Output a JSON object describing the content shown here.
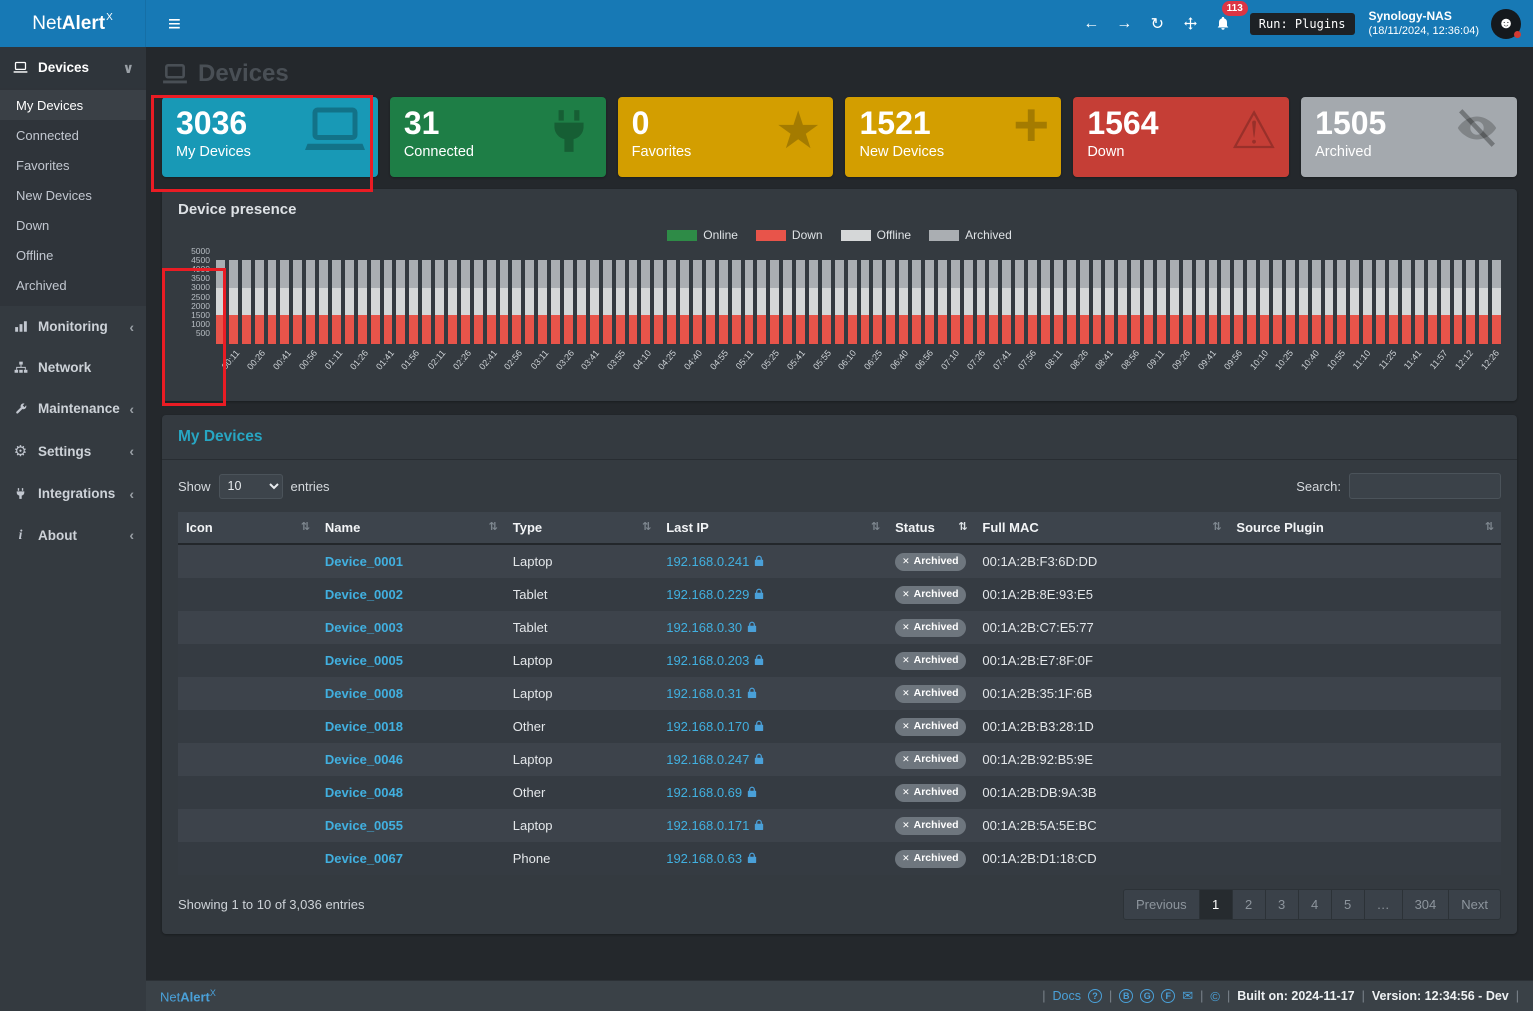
{
  "colors": {
    "topbar": "#1779b5",
    "sidebar": "#343a40",
    "content_bg": "#24282c",
    "panel_bg": "#343a40",
    "link_accent": "#41b0e0",
    "panel_title_cyan": "#27a6c3",
    "annotation_red": "#ea1c24",
    "status_badge_bg": "#6e767e",
    "notification_badge": "#dc3545"
  },
  "topbar": {
    "logo_net": "Net",
    "logo_alert": "Alert",
    "logo_x": "X",
    "notification_count": "113",
    "tooltip": "Run: Plugins",
    "host": "Synology-NAS",
    "timestamp": "(18/11/2024, 12:36:04)"
  },
  "sidebar": {
    "sections": [
      {
        "label": "Devices",
        "icon": "laptop-icon",
        "chevron": "down",
        "active": true
      },
      {
        "label": "Monitoring",
        "icon": "chart-icon",
        "chevron": "left"
      },
      {
        "label": "Network",
        "icon": "network-icon",
        "chevron": "none"
      },
      {
        "label": "Maintenance",
        "icon": "wrench-icon",
        "chevron": "left"
      },
      {
        "label": "Settings",
        "icon": "gear-icon",
        "chevron": "left"
      },
      {
        "label": "Integrations",
        "icon": "plug-icon",
        "chevron": "left"
      },
      {
        "label": "About",
        "icon": "info-icon",
        "chevron": "left"
      }
    ],
    "devices_children": [
      "My Devices",
      "Connected",
      "Favorites",
      "New Devices",
      "Down",
      "Offline",
      "Archived"
    ],
    "active_child": "My Devices"
  },
  "page": {
    "title": "Devices"
  },
  "stat_cards": [
    {
      "value": "3036",
      "label": "My Devices",
      "color": "#1899b6",
      "icon": "laptop-icon",
      "annotated": true
    },
    {
      "value": "31",
      "label": "Connected",
      "color": "#1e7e46",
      "icon": "plug-icon"
    },
    {
      "value": "0",
      "label": "Favorites",
      "color": "#d39e00",
      "icon": "star-icon"
    },
    {
      "value": "1521",
      "label": "New Devices",
      "color": "#d39e00",
      "icon": "plus-icon"
    },
    {
      "value": "1564",
      "label": "Down",
      "color": "#c53e36",
      "icon": "warning-icon"
    },
    {
      "value": "1505",
      "label": "Archived",
      "color": "#a4a9ae",
      "icon": "eye-slash-icon"
    }
  ],
  "presence": {
    "title": "Device presence",
    "chart_data": {
      "type": "bar",
      "stacked": true,
      "legend_position": "top",
      "bars_per_tick": 2,
      "ylim": [
        0,
        5000
      ],
      "yticks": [
        500,
        1000,
        1500,
        2000,
        2500,
        3000,
        3500,
        4000,
        4500,
        5000
      ],
      "x": [
        "00:11",
        "00:26",
        "00:41",
        "00:56",
        "01:11",
        "01:26",
        "01:41",
        "01:56",
        "02:11",
        "02:26",
        "02:41",
        "02:56",
        "03:11",
        "03:26",
        "03:41",
        "03:55",
        "04:10",
        "04:25",
        "04:40",
        "04:55",
        "05:11",
        "05:25",
        "05:41",
        "05:55",
        "06:10",
        "06:25",
        "06:40",
        "06:56",
        "07:10",
        "07:26",
        "07:41",
        "07:56",
        "08:11",
        "08:26",
        "08:41",
        "08:56",
        "09:11",
        "09:26",
        "09:41",
        "09:56",
        "10:10",
        "10:25",
        "10:40",
        "10:55",
        "11:10",
        "11:25",
        "11:41",
        "11:57",
        "12:12",
        "12:26"
      ],
      "series": [
        {
          "name": "Online",
          "color": "#2e8b47",
          "values": [
            0,
            0,
            0,
            0,
            0,
            0,
            0,
            0,
            0,
            0,
            0,
            0,
            0,
            0,
            0,
            0,
            0,
            0,
            0,
            0,
            0,
            0,
            0,
            0,
            0,
            0,
            0,
            0,
            0,
            0,
            0,
            0,
            0,
            0,
            0,
            0,
            0,
            0,
            0,
            0,
            0,
            0,
            0,
            0,
            0,
            0,
            0,
            0,
            0,
            0
          ]
        },
        {
          "name": "Down",
          "color": "#e8544a",
          "values": [
            1564,
            1564,
            1564,
            1564,
            1564,
            1564,
            1564,
            1564,
            1564,
            1564,
            1564,
            1564,
            1564,
            1564,
            1564,
            1564,
            1564,
            1564,
            1564,
            1564,
            1564,
            1564,
            1564,
            1564,
            1564,
            1564,
            1564,
            1564,
            1564,
            1564,
            1564,
            1564,
            1564,
            1564,
            1564,
            1564,
            1564,
            1564,
            1564,
            1564,
            1564,
            1564,
            1564,
            1564,
            1564,
            1564,
            1564,
            1564,
            1564,
            1564
          ]
        },
        {
          "name": "Offline",
          "color": "#d5d7d8",
          "values": [
            1490,
            1490,
            1490,
            1490,
            1490,
            1490,
            1490,
            1490,
            1490,
            1490,
            1490,
            1490,
            1490,
            1490,
            1490,
            1490,
            1490,
            1490,
            1490,
            1490,
            1490,
            1490,
            1490,
            1490,
            1490,
            1490,
            1490,
            1490,
            1490,
            1490,
            1490,
            1490,
            1490,
            1490,
            1490,
            1490,
            1490,
            1490,
            1490,
            1490,
            1490,
            1490,
            1490,
            1490,
            1490,
            1490,
            1490,
            1490,
            1490,
            1490
          ]
        },
        {
          "name": "Archived",
          "color": "#aaaeb2",
          "values": [
            1505,
            1505,
            1505,
            1505,
            1505,
            1505,
            1505,
            1505,
            1505,
            1505,
            1505,
            1505,
            1505,
            1505,
            1505,
            1505,
            1505,
            1505,
            1505,
            1505,
            1505,
            1505,
            1505,
            1505,
            1505,
            1505,
            1505,
            1505,
            1505,
            1505,
            1505,
            1505,
            1505,
            1505,
            1505,
            1505,
            1505,
            1505,
            1505,
            1505,
            1505,
            1505,
            1505,
            1505,
            1505,
            1505,
            1505,
            1505,
            1505,
            1505
          ]
        }
      ]
    }
  },
  "table": {
    "title": "My Devices",
    "controls": {
      "show_label": "Show",
      "page_length": "10",
      "entries_label": "entries",
      "search_label": "Search:",
      "search_value": ""
    },
    "columns": [
      {
        "label": "Icon"
      },
      {
        "label": "Name"
      },
      {
        "label": "Type"
      },
      {
        "label": "Last IP"
      },
      {
        "label": "Status",
        "sorted": true
      },
      {
        "label": "Full MAC"
      },
      {
        "label": "Source Plugin"
      }
    ],
    "rows": [
      {
        "name": "Device_0001",
        "type": "Laptop",
        "ip": "192.168.0.241",
        "status": "Archived",
        "mac": "00:1A:2B:F3:6D:DD",
        "source_plugin": ""
      },
      {
        "name": "Device_0002",
        "type": "Tablet",
        "ip": "192.168.0.229",
        "status": "Archived",
        "mac": "00:1A:2B:8E:93:E5",
        "source_plugin": ""
      },
      {
        "name": "Device_0003",
        "type": "Tablet",
        "ip": "192.168.0.30",
        "status": "Archived",
        "mac": "00:1A:2B:C7:E5:77",
        "source_plugin": ""
      },
      {
        "name": "Device_0005",
        "type": "Laptop",
        "ip": "192.168.0.203",
        "status": "Archived",
        "mac": "00:1A:2B:E7:8F:0F",
        "source_plugin": ""
      },
      {
        "name": "Device_0008",
        "type": "Laptop",
        "ip": "192.168.0.31",
        "status": "Archived",
        "mac": "00:1A:2B:35:1F:6B",
        "source_plugin": ""
      },
      {
        "name": "Device_0018",
        "type": "Other",
        "ip": "192.168.0.170",
        "status": "Archived",
        "mac": "00:1A:2B:B3:28:1D",
        "source_plugin": ""
      },
      {
        "name": "Device_0046",
        "type": "Laptop",
        "ip": "192.168.0.247",
        "status": "Archived",
        "mac": "00:1A:2B:92:B5:9E",
        "source_plugin": ""
      },
      {
        "name": "Device_0048",
        "type": "Other",
        "ip": "192.168.0.69",
        "status": "Archived",
        "mac": "00:1A:2B:DB:9A:3B",
        "source_plugin": ""
      },
      {
        "name": "Device_0055",
        "type": "Laptop",
        "ip": "192.168.0.171",
        "status": "Archived",
        "mac": "00:1A:2B:5A:5E:BC",
        "source_plugin": ""
      },
      {
        "name": "Device_0067",
        "type": "Phone",
        "ip": "192.168.0.63",
        "status": "Archived",
        "mac": "00:1A:2B:D1:18:CD",
        "source_plugin": ""
      }
    ],
    "info": "Showing 1 to 10 of 3,036 entries",
    "pagination": {
      "prev_label": "Previous",
      "pages": [
        "1",
        "2",
        "3",
        "4",
        "5",
        "…",
        "304"
      ],
      "active_page": "1",
      "next_label": "Next"
    }
  },
  "footer": {
    "brand_net": "Net",
    "brand_alert": "Alert",
    "brand_x": "X",
    "docs_label": "Docs",
    "built_label": "Built on: 2024-11-17",
    "version_label": "Version: 12:34:56 - Dev"
  }
}
